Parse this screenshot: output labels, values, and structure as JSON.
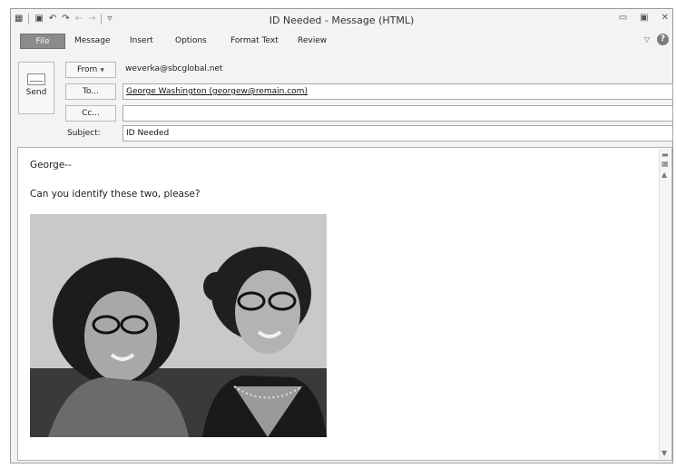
{
  "window": {
    "title": "ID Needed - Message (HTML)",
    "controls": {
      "minimize": "▭",
      "maximize": "▣",
      "close": "✕"
    }
  },
  "quick_access": {
    "customize": "▿"
  },
  "ribbon": {
    "tabs": [
      "File",
      "Message",
      "Insert",
      "Options",
      "Format Text",
      "Review"
    ]
  },
  "header": {
    "send_label": "Send",
    "from_label": "From",
    "from_value": "weverka@sbcglobal.net",
    "to_label": "To...",
    "to_value": "George Washington (georgew@remain.com)",
    "cc_label": "Cc...",
    "cc_value": "",
    "subject_label": "Subject:",
    "subject_value": "ID Needed"
  },
  "message": {
    "greeting": "George--",
    "line1": "Can you identify these two, please?"
  },
  "colors": {
    "file_tab": "#8b8b8b",
    "window_bg": "#f3f3f3",
    "field_border": "#a8a8a8"
  }
}
